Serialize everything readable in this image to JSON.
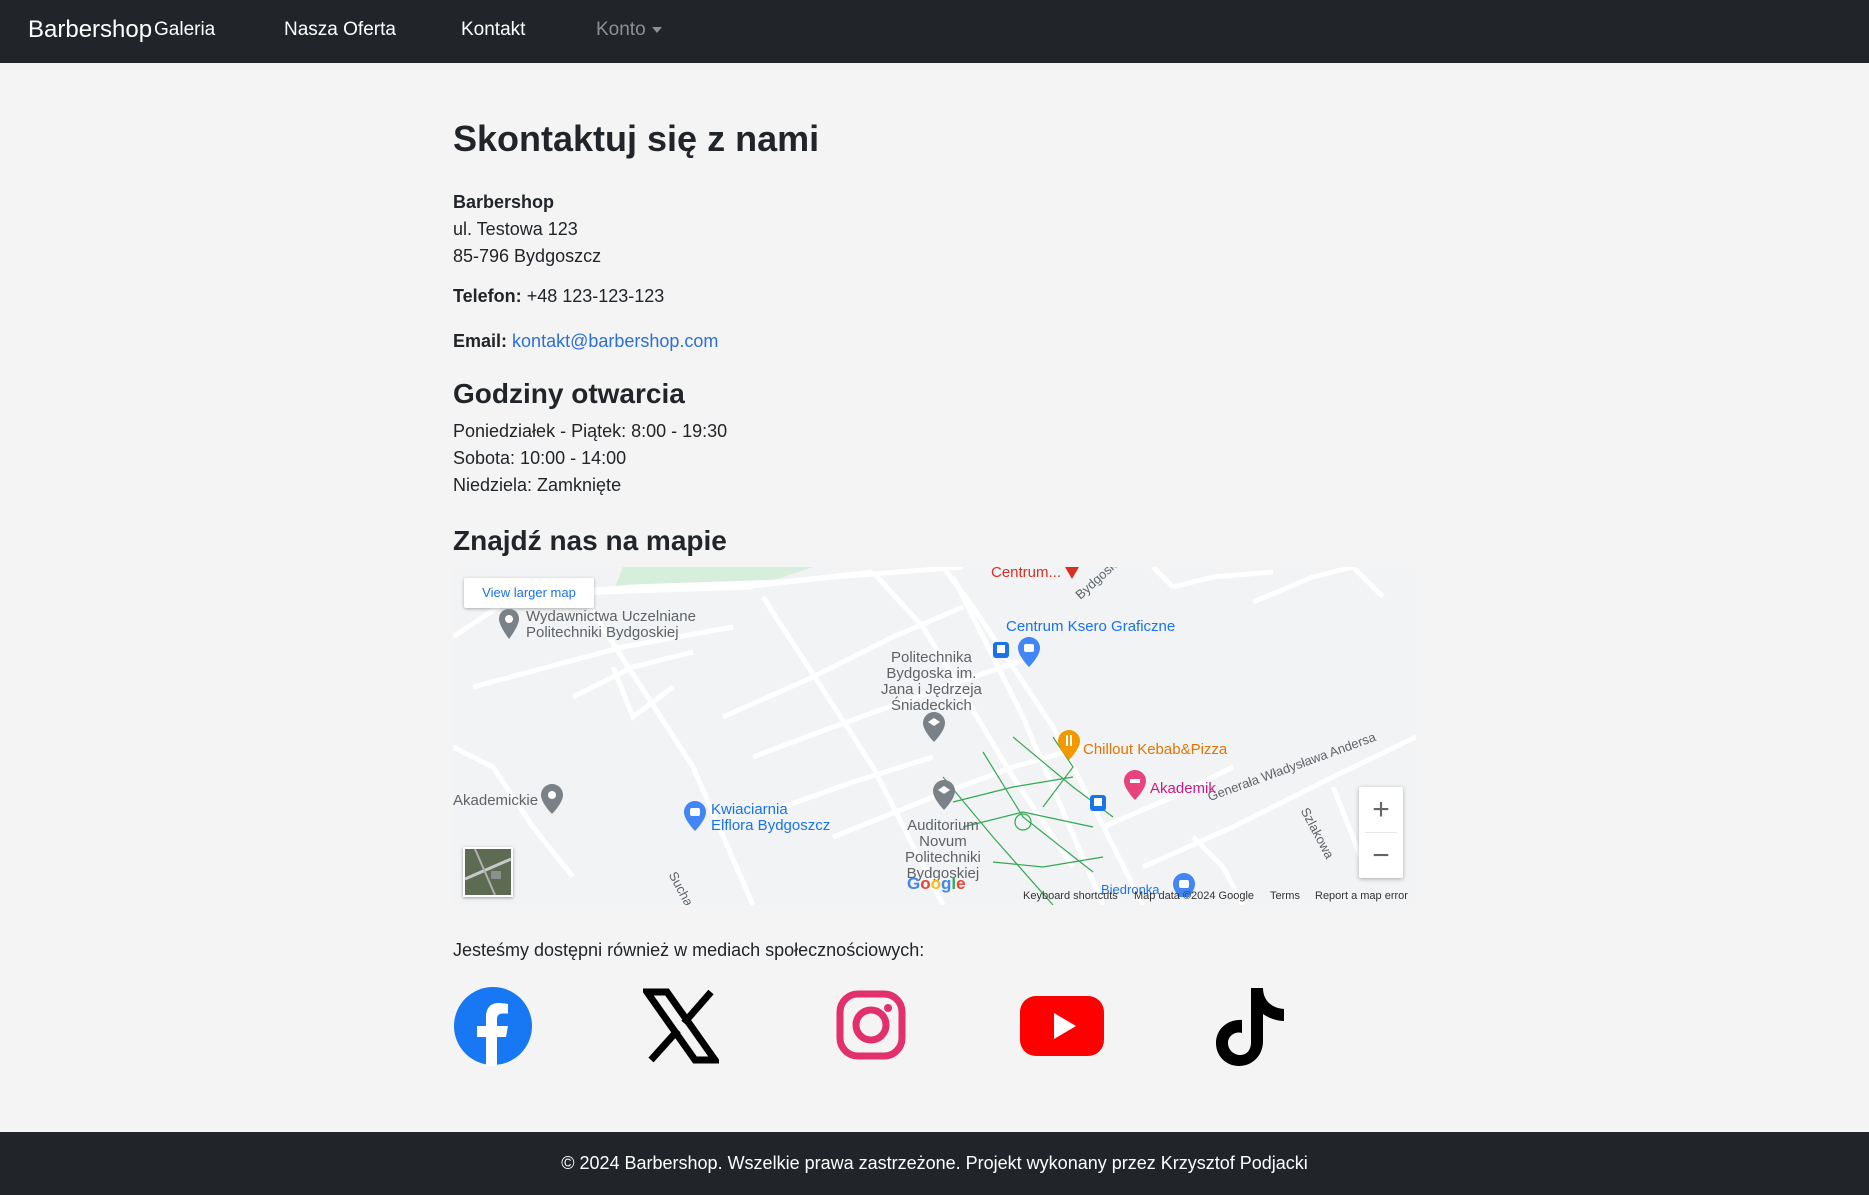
{
  "nav": {
    "brand": "Barbershop",
    "items": [
      "Galeria",
      "Nasza Oferta",
      "Kontakt"
    ],
    "account": "Konto"
  },
  "contact": {
    "title": "Skontaktuj się z nami",
    "name": "Barbershop",
    "street": "ul. Testowa 123",
    "city": "85-796 Bydgoszcz",
    "phone_label": "Telefon:",
    "phone": "+48 123-123-123",
    "email_label": "Email:",
    "email": "kontakt@barbershop.com"
  },
  "hours": {
    "title": "Godziny otwarcia",
    "lines": [
      "Poniedziałek - Piątek: 8:00 - 19:30",
      "Sobota: 10:00 - 14:00",
      "Niedziela: Zamknięte"
    ]
  },
  "map": {
    "title": "Znajdź nas na mapie",
    "view_larger": "View larger map",
    "labels": {
      "wydawnictwa": "Wydawnictwa Uczelniane\nPolitechniki Bydgoskiej",
      "centrum_top": "Centrum...",
      "ksero": "Centrum Ksero Graficzne",
      "politechnika": "Politechnika\nBydgoska im.\nJana i Jędrzeja\nŚniadeckich",
      "chillout": "Chillout Kebab&Pizza",
      "akademik": "Akademik",
      "akademickie": "Akademickie",
      "kwiaciarnia": "Kwiaciarnia\nElflora Bydgoszcz",
      "auditorium": "Auditorium\nNovum\nPolitechniki\nBydgoskiej",
      "andersa": "Generała Władysława Andersa",
      "szlakowa": "Szlakowa",
      "sucha": "Sucha",
      "bydgoska": "Bydgoska",
      "biedronka": "Biedronka"
    },
    "footer": {
      "shortcuts": "Keyboard shortcuts",
      "data": "Map data ©2024 Google",
      "terms": "Terms",
      "report": "Report a map error"
    },
    "zoom_in": "+",
    "zoom_out": "−",
    "google": "Google"
  },
  "social": {
    "text": "Jesteśmy dostępni również w mediach społecznościowych:",
    "items": [
      "facebook-icon",
      "x-icon",
      "instagram-icon",
      "youtube-icon",
      "tiktok-icon"
    ]
  },
  "footer": {
    "text": "© 2024 Barbershop. Wszelkie prawa zastrzeżone. Projekt wykonany przez Krzysztof Podjacki"
  },
  "colors": {
    "navbar": "#212529",
    "link": "#2b6fd6",
    "facebook": "#1877f2",
    "instagram": "#e1306c",
    "youtube": "#ff0000"
  }
}
